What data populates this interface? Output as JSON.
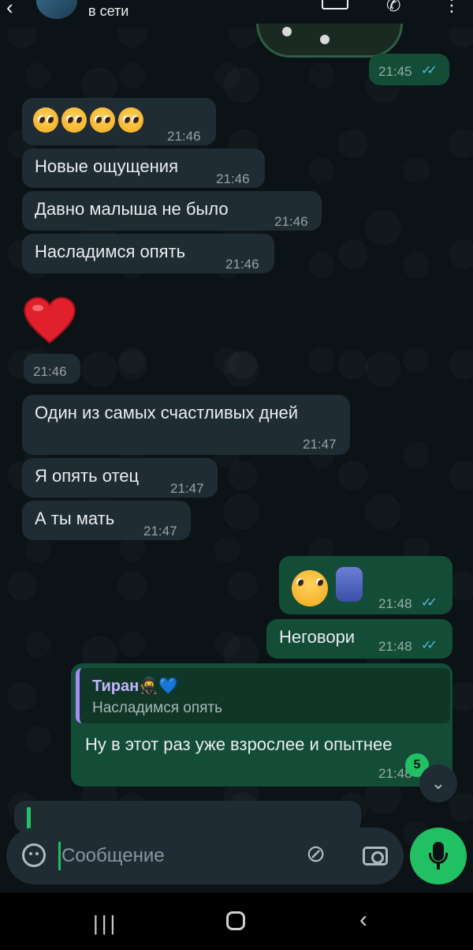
{
  "header": {
    "status": "в сети"
  },
  "messages": {
    "m0": {
      "time": "21:45"
    },
    "m1": {
      "time": "21:46"
    },
    "m2": {
      "text": "Новые ощущения",
      "time": "21:46"
    },
    "m3": {
      "text": "Давно малыша не было",
      "time": "21:46"
    },
    "m4": {
      "text": "Насладимся опять",
      "time": "21:46"
    },
    "m5": {
      "time": "21:46"
    },
    "m6": {
      "text": "Один из самых счастливых дней",
      "time": "21:47"
    },
    "m7": {
      "text": "Я опять отец",
      "time": "21:47"
    },
    "m8": {
      "text": "А ты мать",
      "time": "21:47"
    },
    "m9": {
      "time": "21:48"
    },
    "m10": {
      "text": "Неговори",
      "time": "21:48"
    },
    "m11": {
      "reply_name": "Тиран🥷💙",
      "reply_text": "Насладимся опять",
      "text": "Ну в этот раз уже взрослее и опытнее",
      "time": "21:48"
    }
  },
  "unread_count": "5",
  "composer": {
    "placeholder": "Сообщение"
  },
  "icons": {
    "read_ticks": "double-check-icon",
    "colors": {
      "incoming": "#1f2c33",
      "outgoing": "#144d37",
      "accent": "#21c063",
      "ticks": "#53bdeb"
    }
  }
}
